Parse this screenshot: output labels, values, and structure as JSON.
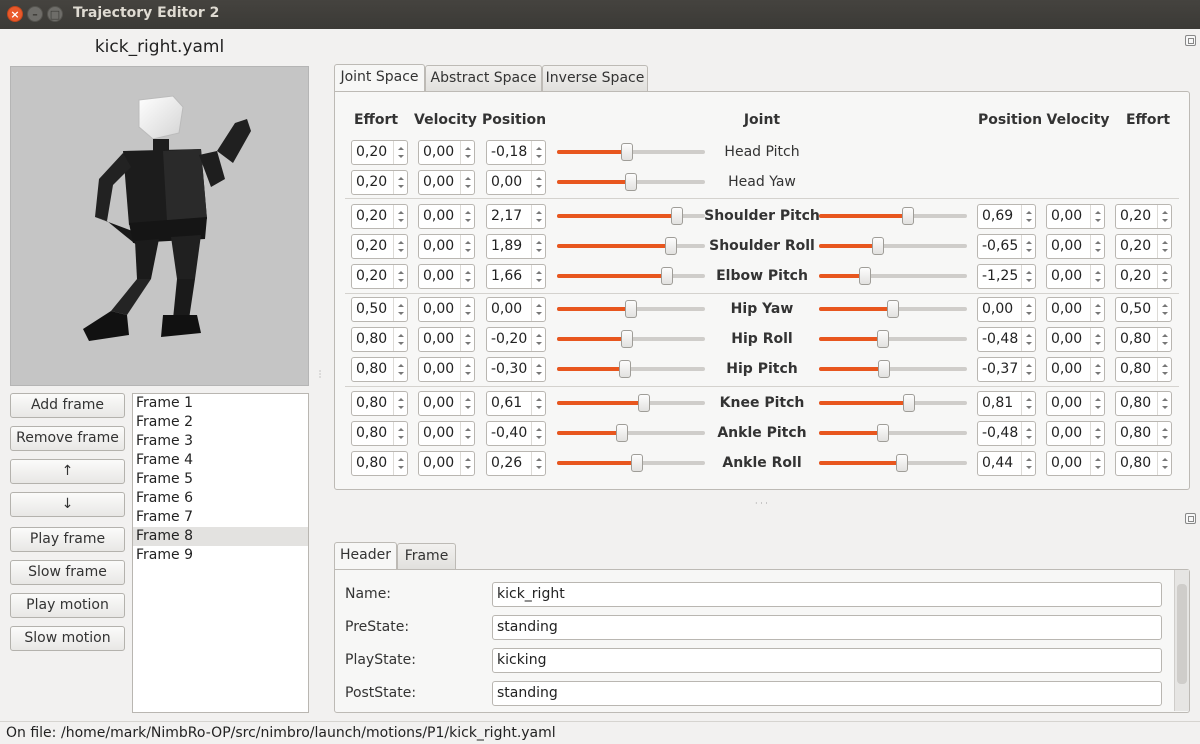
{
  "window": {
    "title": "Trajectory Editor 2",
    "close": "×",
    "minimize": "–",
    "maximize": "□"
  },
  "file_title": "kick_right.yaml",
  "buttons": [
    {
      "label": "Add frame",
      "name": "add-frame-button"
    },
    {
      "label": "Remove frame",
      "name": "remove-frame-button"
    },
    {
      "label": "↑",
      "name": "move-up-button"
    },
    {
      "label": "↓",
      "name": "move-down-button"
    },
    {
      "label": "Play frame",
      "name": "play-frame-button"
    },
    {
      "label": "Slow frame",
      "name": "slow-frame-button"
    },
    {
      "label": "Play motion",
      "name": "play-motion-button"
    },
    {
      "label": "Slow motion",
      "name": "slow-motion-button"
    }
  ],
  "frames": [
    "Frame 1",
    "Frame 2",
    "Frame 3",
    "Frame 4",
    "Frame 5",
    "Frame 6",
    "Frame 7",
    "Frame 8",
    "Frame 9"
  ],
  "selected_frame_index": 7,
  "top_tabs": [
    "Joint Space",
    "Abstract Space",
    "Inverse Space"
  ],
  "joint_headers": {
    "left_effort": "Effort",
    "left_velocity": "Velocity",
    "left_position": "Position",
    "joint": "Joint",
    "right_position": "Position",
    "right_velocity": "Velocity",
    "right_effort": "Effort"
  },
  "accent_color": "#e8561e",
  "joints": [
    {
      "name": "Head Pitch",
      "bold": false,
      "left": {
        "effort": "0,20",
        "velocity": "0,00",
        "position": "-0,18",
        "slider": 0.47
      },
      "right": null
    },
    {
      "name": "Head Yaw",
      "bold": false,
      "left": {
        "effort": "0,20",
        "velocity": "0,00",
        "position": "0,00",
        "slider": 0.5
      },
      "right": null
    },
    {
      "name": "Shoulder Pitch",
      "bold": true,
      "left": {
        "effort": "0,20",
        "velocity": "0,00",
        "position": "2,17",
        "slider": 0.81
      },
      "right": {
        "effort": "0,20",
        "velocity": "0,00",
        "position": "0,69",
        "slider": 0.6
      }
    },
    {
      "name": "Shoulder Roll",
      "bold": true,
      "left": {
        "effort": "0,20",
        "velocity": "0,00",
        "position": "1,89",
        "slider": 0.77
      },
      "right": {
        "effort": "0,20",
        "velocity": "0,00",
        "position": "-0,65",
        "slider": 0.4
      }
    },
    {
      "name": "Elbow Pitch",
      "bold": true,
      "left": {
        "effort": "0,20",
        "velocity": "0,00",
        "position": "1,66",
        "slider": 0.74
      },
      "right": {
        "effort": "0,20",
        "velocity": "0,00",
        "position": "-1,25",
        "slider": 0.31
      }
    },
    {
      "name": "Hip Yaw",
      "bold": true,
      "left": {
        "effort": "0,50",
        "velocity": "0,00",
        "position": "0,00",
        "slider": 0.5
      },
      "right": {
        "effort": "0,50",
        "velocity": "0,00",
        "position": "0,00",
        "slider": 0.5
      }
    },
    {
      "name": "Hip Roll",
      "bold": true,
      "left": {
        "effort": "0,80",
        "velocity": "0,00",
        "position": "-0,20",
        "slider": 0.47
      },
      "right": {
        "effort": "0,80",
        "velocity": "0,00",
        "position": "-0,48",
        "slider": 0.43
      }
    },
    {
      "name": "Hip Pitch",
      "bold": true,
      "left": {
        "effort": "0,80",
        "velocity": "0,00",
        "position": "-0,30",
        "slider": 0.46
      },
      "right": {
        "effort": "0,80",
        "velocity": "0,00",
        "position": "-0,37",
        "slider": 0.44
      }
    },
    {
      "name": "Knee Pitch",
      "bold": true,
      "left": {
        "effort": "0,80",
        "velocity": "0,00",
        "position": "0,61",
        "slider": 0.59
      },
      "right": {
        "effort": "0,80",
        "velocity": "0,00",
        "position": "0,81",
        "slider": 0.61
      }
    },
    {
      "name": "Ankle Pitch",
      "bold": true,
      "left": {
        "effort": "0,80",
        "velocity": "0,00",
        "position": "-0,40",
        "slider": 0.44
      },
      "right": {
        "effort": "0,80",
        "velocity": "0,00",
        "position": "-0,48",
        "slider": 0.43
      }
    },
    {
      "name": "Ankle Roll",
      "bold": true,
      "left": {
        "effort": "0,80",
        "velocity": "0,00",
        "position": "0,26",
        "slider": 0.54
      },
      "right": {
        "effort": "0,80",
        "velocity": "0,00",
        "position": "0,44",
        "slider": 0.56
      }
    }
  ],
  "bottom_tabs": [
    "Header",
    "Frame"
  ],
  "header_fields": [
    {
      "label": "Name:",
      "value": "kick_right"
    },
    {
      "label": "PreState:",
      "value": "standing"
    },
    {
      "label": "PlayState:",
      "value": "kicking"
    },
    {
      "label": "PostState:",
      "value": "standing"
    }
  ],
  "status": {
    "label": "On file:",
    "path": "/home/mark/NimbRo-OP/src/nimbro/launch/motions/P1/kick_right.yaml"
  }
}
